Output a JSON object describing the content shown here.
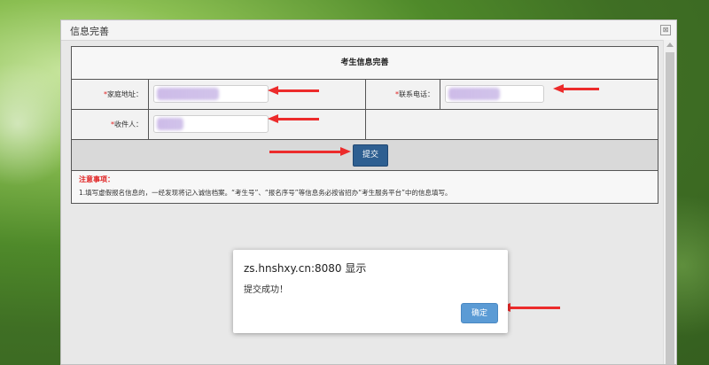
{
  "window": {
    "title": "信息完善",
    "close_glyph": "⊠"
  },
  "form": {
    "title": "考生信息完善",
    "required_mark": "*",
    "fields": {
      "address_label": "家庭地址：",
      "phone_label": "联系电话：",
      "recipient_label": "收件人："
    },
    "submit_label": "提交",
    "notes_title": "注意事项：",
    "notes_text": "1.填写虚假报名信息的，一经发现将记入诚信档案。“考生号”、“报名序号”等信息务必按省招办“考生服务平台”中的信息填写。"
  },
  "alert": {
    "title": "zs.hnshxy.cn:8080 显示",
    "message": "提交成功！",
    "ok_label": "确定"
  },
  "colors": {
    "accent_button": "#2e5f91",
    "alert_button": "#5b9bd5",
    "arrow": "#ec2b2b",
    "required": "#e02020"
  }
}
